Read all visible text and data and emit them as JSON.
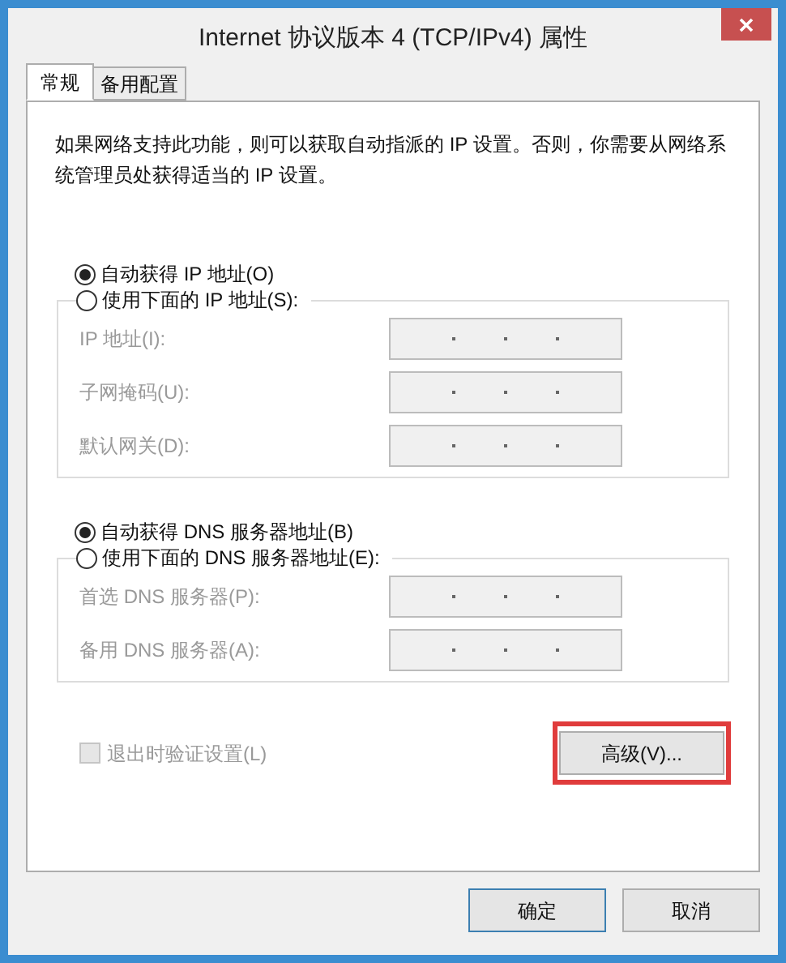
{
  "window": {
    "title": "Internet 协议版本 4 (TCP/IPv4) 属性"
  },
  "tabs": [
    {
      "label": "常规",
      "selected": true
    },
    {
      "label": "备用配置",
      "selected": false
    }
  ],
  "description": "如果网络支持此功能，则可以获取自动指派的 IP 设置。否则，你需要从网络系统管理员处获得适当的 IP 设置。",
  "ip": {
    "options": [
      {
        "label": "自动获得 IP 地址(O)",
        "selected": true
      },
      {
        "label": "使用下面的 IP 地址(S):",
        "selected": false
      }
    ],
    "fields": [
      {
        "label": "IP 地址(I):",
        "disabled": true
      },
      {
        "label": "子网掩码(U):",
        "disabled": true
      },
      {
        "label": "默认网关(D):",
        "disabled": true
      }
    ]
  },
  "dns": {
    "options": [
      {
        "label": "自动获得 DNS 服务器地址(B)",
        "selected": true
      },
      {
        "label": "使用下面的 DNS 服务器地址(E):",
        "selected": false
      }
    ],
    "fields": [
      {
        "label": "首选 DNS 服务器(P):",
        "disabled": true
      },
      {
        "label": "备用 DNS 服务器(A):",
        "disabled": true
      }
    ]
  },
  "validate_checkbox": {
    "label": "退出时验证设置(L)",
    "checked": false,
    "disabled": true
  },
  "advanced_button": {
    "label": "高级(V)...",
    "highlighted": true
  },
  "buttons": [
    {
      "label": "确定",
      "default": true
    },
    {
      "label": "取消",
      "default": false
    }
  ]
}
